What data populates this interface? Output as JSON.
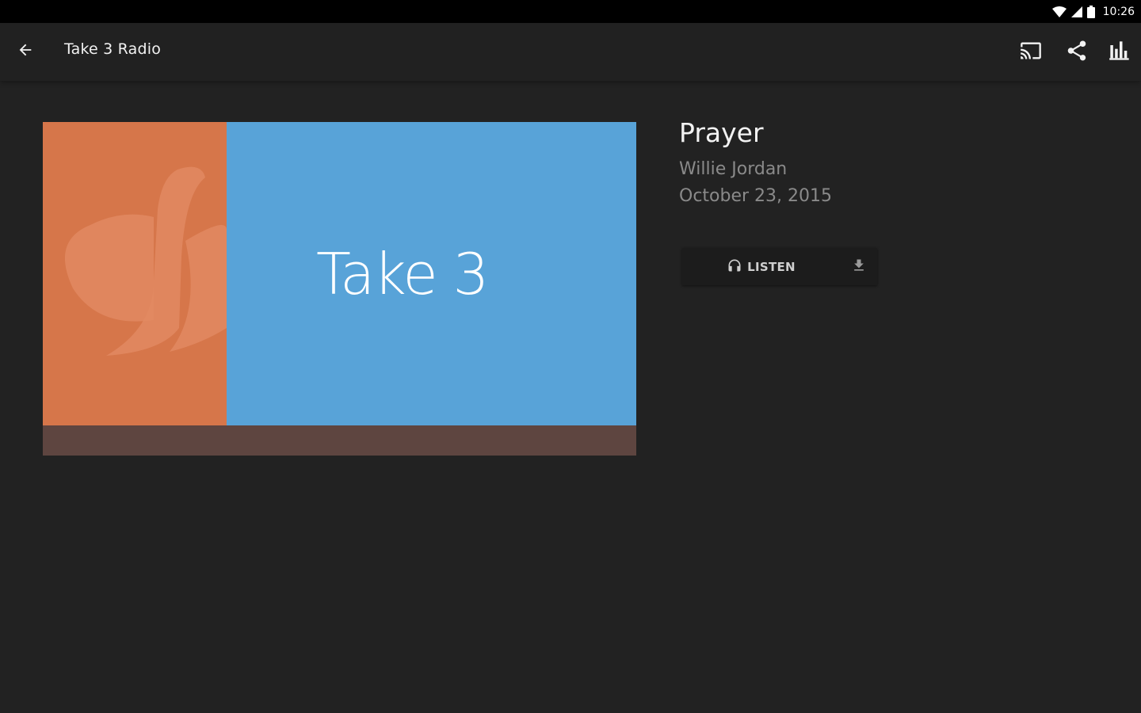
{
  "status_bar": {
    "time": "10:26",
    "icons": [
      "wifi-icon",
      "cell-signal-icon",
      "battery-icon"
    ]
  },
  "app_bar": {
    "title": "Take 3 Radio",
    "back_icon": "arrow-left-icon",
    "actions": [
      "cast-icon",
      "share-icon",
      "equalizer-icon"
    ]
  },
  "artwork": {
    "text": "Take 3",
    "logo_icon": "music-note-logo-icon",
    "colors": {
      "left_panel": "#d6764a",
      "right_panel": "#58a3d8",
      "bottom_strip": "#5e4540"
    }
  },
  "episode": {
    "title": "Prayer",
    "author": "Willie Jordan",
    "date": "October 23, 2015"
  },
  "actions": {
    "listen_label": "LISTEN",
    "listen_icon": "headphones-icon",
    "download_icon": "download-icon"
  },
  "colors": {
    "background": "#222222",
    "app_bar": "#212121",
    "status_bar": "#000000",
    "primary_text": "#f2f2f2",
    "secondary_text": "#8a8a8a"
  }
}
